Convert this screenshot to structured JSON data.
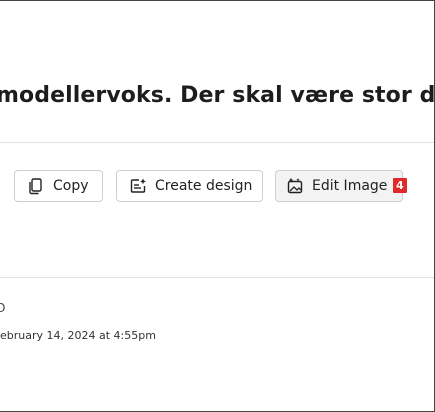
{
  "message": {
    "prompt_text": "modellervoks. Der skal være stor dybd",
    "meta_glyph": "O",
    "timestamp": "ebruary 14, 2024 at 4:55pm"
  },
  "toolbar": {
    "copy_label": "Copy",
    "create_design_label": "Create design",
    "edit_image_label": "Edit Image",
    "edit_image_badge": "4",
    "copy_icon": "copy-icon",
    "create_design_icon": "create-design-icon",
    "edit_image_icon": "edit-image-icon"
  },
  "colors": {
    "badge": "#e02b2b",
    "text": "#1d1d1d",
    "border": "#cfcfcf"
  }
}
